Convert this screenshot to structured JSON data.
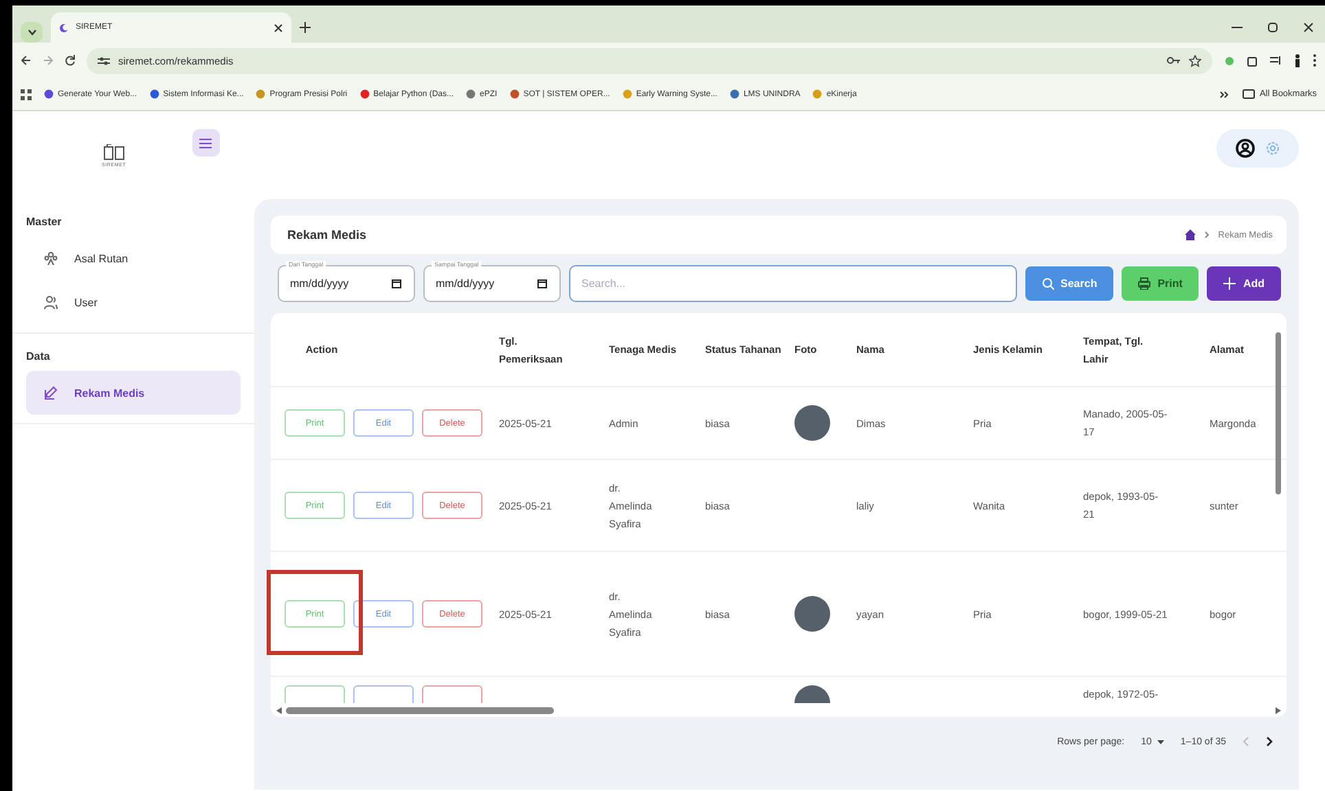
{
  "browser": {
    "tab_title": "SIREMET",
    "url": "siremet.com/rekammedis",
    "bookmarks": [
      {
        "label": "Generate Your Web...",
        "color": "#5b4bd6"
      },
      {
        "label": "Sistem Informasi Ke...",
        "color": "#2a5bd7"
      },
      {
        "label": "Program Presisi Polri",
        "color": "#c8961e"
      },
      {
        "label": "Belajar Python (Das...",
        "color": "#e02424"
      },
      {
        "label": "ePZI",
        "color": "#777777"
      },
      {
        "label": "SOT | SISTEM OPER...",
        "color": "#c0502a"
      },
      {
        "label": "Early Warning Syste...",
        "color": "#d9a21b"
      },
      {
        "label": "LMS UNINDRA",
        "color": "#3a6fb0"
      },
      {
        "label": "eKinerja",
        "color": "#d4a017"
      }
    ],
    "all_bookmarks": "All Bookmarks"
  },
  "app": {
    "logo_caption": "SIREMET"
  },
  "sidebar": {
    "sections": [
      {
        "title": "Master",
        "items": [
          {
            "label": "Asal Rutan",
            "selected": false
          },
          {
            "label": "User",
            "selected": false
          }
        ]
      },
      {
        "title": "Data",
        "items": [
          {
            "label": "Rekam Medis",
            "selected": true
          }
        ]
      }
    ]
  },
  "page": {
    "title": "Rekam Medis",
    "breadcrumb": "Rekam Medis",
    "filters": [
      {
        "label": "Dari Tanggal",
        "placeholder": "mm/dd/yyyy"
      },
      {
        "label": "Sampai Tanggal",
        "placeholder": "mm/dd/yyyy"
      }
    ],
    "search": {
      "placeholder": "Search..."
    },
    "buttons": [
      {
        "label": "Search",
        "kind": "search"
      },
      {
        "label": "Print",
        "kind": "print"
      },
      {
        "label": "Add",
        "kind": "add"
      }
    ]
  },
  "table": {
    "columns": [
      "Action",
      "Tgl. Pemeriksaan",
      "Tenaga Medis",
      "Status Tahanan",
      "Foto",
      "Nama",
      "Jenis Kelamin",
      "Tempat, Tgl. Lahir",
      "Alamat"
    ],
    "rows": [
      {
        "actions": [
          {
            "kind": "print",
            "label": "Print"
          },
          {
            "kind": "edit",
            "label": "Edit"
          },
          {
            "kind": "delete",
            "label": "Delete"
          }
        ],
        "highlighted": false,
        "tgl": "2025-05-21",
        "tenaga": "Admin",
        "status": "biasa",
        "photo": true,
        "nama": "Dimas",
        "jenis": "Pria",
        "tempat": "Manado, 2005-05-17",
        "alamat": "Margonda"
      },
      {
        "actions": [
          {
            "kind": "print",
            "label": "Print"
          },
          {
            "kind": "edit",
            "label": "Edit"
          },
          {
            "kind": "delete",
            "label": "Delete"
          }
        ],
        "highlighted": false,
        "tgl": "2025-05-21",
        "tenaga": "dr. Amelinda Syafira",
        "status": "biasa",
        "photo": false,
        "nama": "laliy",
        "jenis": "Wanita",
        "tempat": "depok, 1993-05-21",
        "alamat": "sunter"
      },
      {
        "actions": [
          {
            "kind": "print",
            "label": "Print"
          },
          {
            "kind": "edit",
            "label": "Edit"
          },
          {
            "kind": "delete",
            "label": "Delete"
          }
        ],
        "highlighted": true,
        "tgl": "2025-05-21",
        "tenaga": "dr. Amelinda Syafira",
        "status": "biasa",
        "photo": true,
        "nama": "yayan",
        "jenis": "Pria",
        "tempat": "bogor, 1999-05-21",
        "alamat": "bogor"
      },
      {
        "actions": [
          {
            "kind": "print"
          },
          {
            "kind": "edit"
          },
          {
            "kind": "delete"
          }
        ],
        "highlighted": false,
        "photo": true,
        "tempat": "depok, 1972-05-"
      }
    ],
    "pagination": {
      "rows_per_page_label": "Rows per page:",
      "rows_per_page": "10",
      "range": "1–10 of 35"
    }
  }
}
